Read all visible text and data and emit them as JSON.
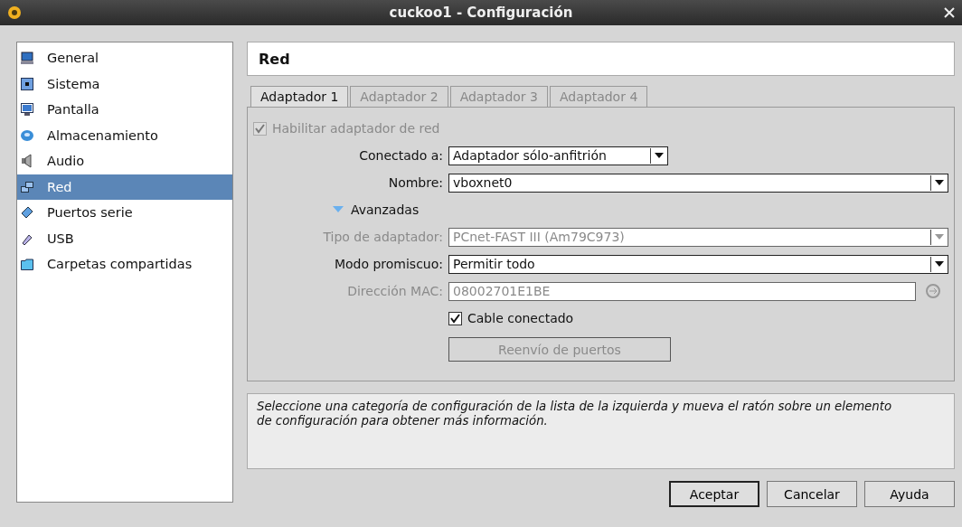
{
  "window": {
    "title": "cuckoo1 - Configuración"
  },
  "sidebar": {
    "items": [
      {
        "label": "General",
        "selected": false
      },
      {
        "label": "Sistema",
        "selected": false
      },
      {
        "label": "Pantalla",
        "selected": false
      },
      {
        "label": "Almacenamiento",
        "selected": false
      },
      {
        "label": "Audio",
        "selected": false
      },
      {
        "label": "Red",
        "selected": true
      },
      {
        "label": "Puertos serie",
        "selected": false
      },
      {
        "label": "USB",
        "selected": false
      },
      {
        "label": "Carpetas compartidas",
        "selected": false
      }
    ]
  },
  "section_title": "Red",
  "tabs": [
    {
      "label": "Adaptador 1",
      "selected": true
    },
    {
      "label": "Adaptador 2",
      "selected": false
    },
    {
      "label": "Adaptador 3",
      "selected": false
    },
    {
      "label": "Adaptador 4",
      "selected": false
    }
  ],
  "enable_adapter": {
    "label": "Habilitar adaptador de red",
    "checked": true,
    "disabled": true
  },
  "fields_top": [
    {
      "kind": "short-combo",
      "label": "Conectado a:",
      "value": "Adaptador sólo-anfitrión",
      "disabled": false
    },
    {
      "kind": "combo",
      "label": "Nombre:",
      "value": "vboxnet0",
      "disabled": false
    }
  ],
  "advanced": {
    "label": "Avanzadas",
    "expanded": true
  },
  "fields_advanced": [
    {
      "kind": "combo",
      "label": "Tipo de adaptador:",
      "value": "PCnet-FAST III (Am79C973)",
      "disabled": true
    },
    {
      "kind": "combo",
      "label": "Modo promiscuo:",
      "value": "Permitir todo",
      "disabled": false
    },
    {
      "kind": "text",
      "label": "Dirección MAC:",
      "value": "08002701E1BE",
      "disabled": true
    }
  ],
  "cable": {
    "label": "Cable conectado",
    "checked": true
  },
  "port_forwarding": {
    "label": "Reenvío de puertos",
    "disabled": true
  },
  "info": "Seleccione una categoría de configuración de la lista de la izquierda y mueva el ratón sobre un elemento de configuración para obtener más información.",
  "buttons": [
    {
      "label": "Aceptar",
      "default": true
    },
    {
      "label": "Cancelar",
      "default": false
    },
    {
      "label": "Ayuda",
      "default": false
    }
  ]
}
